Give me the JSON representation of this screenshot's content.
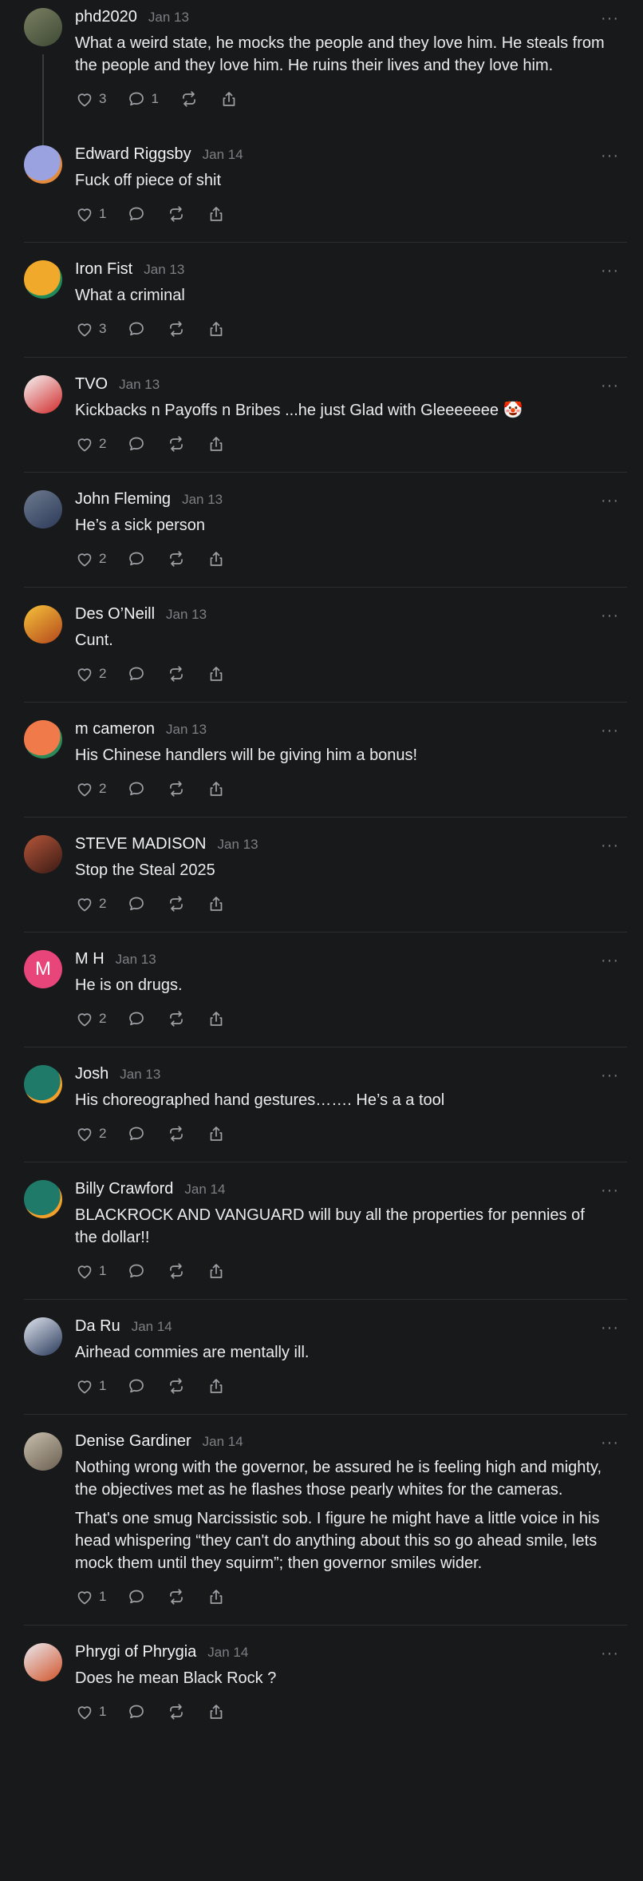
{
  "posts": [
    {
      "author": "phd2020",
      "date": "Jan 13",
      "paragraphs": [
        "What a weird state, he mocks the people and they love him. He steals from the people and they love him. He ruins their lives and they love him."
      ],
      "likes": "3",
      "replies": "1",
      "avatar": {
        "type": "photo",
        "colors": [
          "#7a7f62",
          "#3e4a35"
        ]
      },
      "thread_line": true
    },
    {
      "author": "Edward Riggsby",
      "date": "Jan 14",
      "paragraphs": [
        "Fuck off piece of shit"
      ],
      "likes": "1",
      "replies": "",
      "avatar": {
        "type": "blob",
        "colors": [
          "#9aa3df",
          "#e48a3c"
        ]
      }
    },
    {
      "author": "Iron Fist",
      "date": "Jan 13",
      "paragraphs": [
        "What a criminal"
      ],
      "likes": "3",
      "replies": "",
      "avatar": {
        "type": "blob",
        "colors": [
          "#f0a92b",
          "#1f8a5a"
        ]
      }
    },
    {
      "author": "TVO",
      "date": "Jan 13",
      "paragraphs": [
        "Kickbacks n Payoffs n Bribes ...he just Glad with Gleeeeeee 🤡"
      ],
      "likes": "2",
      "replies": "",
      "avatar": {
        "type": "photo",
        "colors": [
          "#f5f5f5",
          "#d22a2a"
        ]
      }
    },
    {
      "author": "John Fleming",
      "date": "Jan 13",
      "paragraphs": [
        "He’s a sick person"
      ],
      "likes": "2",
      "replies": "",
      "avatar": {
        "type": "photo",
        "colors": [
          "#6d7a8e",
          "#2c3a5a"
        ]
      }
    },
    {
      "author": "Des O’Neill",
      "date": "Jan 13",
      "paragraphs": [
        "Cunt."
      ],
      "likes": "2",
      "replies": "",
      "avatar": {
        "type": "photo",
        "colors": [
          "#f6c23a",
          "#b3471c"
        ]
      }
    },
    {
      "author": "m cameron",
      "date": "Jan 13",
      "paragraphs": [
        "His Chinese handlers will be giving him a bonus!"
      ],
      "likes": "2",
      "replies": "",
      "avatar": {
        "type": "blob",
        "colors": [
          "#f07a4a",
          "#2a8a5a"
        ]
      }
    },
    {
      "author": "STEVE MADISON",
      "date": "Jan 13",
      "paragraphs": [
        "Stop the Steal 2025"
      ],
      "likes": "2",
      "replies": "",
      "avatar": {
        "type": "photo",
        "colors": [
          "#b5563a",
          "#3a1a14"
        ]
      }
    },
    {
      "author": "M H",
      "date": "Jan 13",
      "paragraphs": [
        "He is on drugs."
      ],
      "likes": "2",
      "replies": "",
      "avatar": {
        "type": "letter",
        "letter": "M",
        "colors": [
          "#e8457a",
          "#e8457a"
        ]
      }
    },
    {
      "author": "Josh",
      "date": "Jan 13",
      "paragraphs": [
        "His choreographed hand gestures……. He’s a a tool"
      ],
      "likes": "2",
      "replies": "",
      "avatar": {
        "type": "blob",
        "colors": [
          "#1f7a6a",
          "#f2a02a"
        ]
      }
    },
    {
      "author": "Billy Crawford",
      "date": "Jan 14",
      "paragraphs": [
        "BLACKROCK AND VANGUARD will buy all the properties for pennies of the dollar!!"
      ],
      "likes": "1",
      "replies": "",
      "avatar": {
        "type": "blob",
        "colors": [
          "#1f7a6a",
          "#f2a02a"
        ]
      }
    },
    {
      "author": "Da Ru",
      "date": "Jan 14",
      "paragraphs": [
        "Airhead commies are mentally ill."
      ],
      "likes": "1",
      "replies": "",
      "avatar": {
        "type": "photo",
        "colors": [
          "#dfe4ee",
          "#2a3a5a"
        ]
      }
    },
    {
      "author": "Denise Gardiner",
      "date": "Jan 14",
      "paragraphs": [
        "Nothing wrong with the governor, be assured he is feeling high and mighty, the objectives met as he flashes those pearly whites for the cameras.",
        "That's one smug Narcissistic sob. I figure he might have a little voice in his head whispering “they can't do anything about this so go ahead smile, lets mock them until they squirm”; then governor smiles wider."
      ],
      "likes": "1",
      "replies": "",
      "avatar": {
        "type": "photo",
        "colors": [
          "#c9bfae",
          "#6a5f50"
        ]
      }
    },
    {
      "author": "Phrygi of Phrygia",
      "date": "Jan 14",
      "paragraphs": [
        "Does he mean Black Rock ?"
      ],
      "likes": "1",
      "replies": "",
      "avatar": {
        "type": "photo",
        "colors": [
          "#e9e9ef",
          "#d2542a"
        ]
      }
    }
  ]
}
